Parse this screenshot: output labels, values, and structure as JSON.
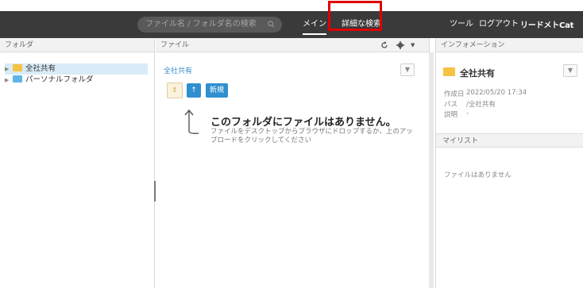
{
  "topbar": {
    "search_placeholder": "ファイル名 / フォルダ名の検索",
    "nav_main": "メイン",
    "nav_advanced": "詳細な検索",
    "nav_tools": "ツール",
    "nav_logout": "ログアウト",
    "brand": "リードメトCat"
  },
  "left": {
    "header": "フォルダ",
    "tree": [
      {
        "label": "全社共有",
        "selected": true
      },
      {
        "label": "パーソナルフォルダ",
        "selected": false
      }
    ]
  },
  "mid": {
    "header": "ファイル",
    "breadcrumb": "全社共有",
    "new_button": "新規",
    "empty_title": "このフォルダにファイルはありません。",
    "empty_sub": "ファイルをデスクトップからブラウザにドロップするか、上のアップロードをクリックしてください"
  },
  "right": {
    "header": "インフォメーション",
    "folder_name": "全社共有",
    "created_label": "作成日",
    "created_value": "2022/05/20 17:34",
    "path_label": "パス",
    "path_value": "/全社共有",
    "desc_label": "説明",
    "desc_value": "-",
    "mylist_header": "マイリスト",
    "mylist_empty": "ファイルはありません"
  },
  "colors": {
    "topbar": "#3a3a3a",
    "accent": "#2f8fd0",
    "folder_yellow": "#f5c242",
    "folder_blue": "#5fb6e6",
    "highlight": "#e00000"
  }
}
